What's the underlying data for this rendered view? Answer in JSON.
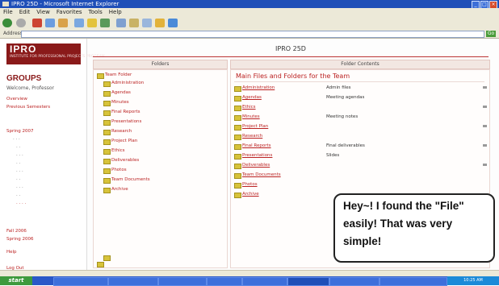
{
  "window": {
    "title": "IPRO 25D - Microsoft Internet Explorer"
  },
  "menu": [
    "File",
    "Edit",
    "View",
    "Favorites",
    "Tools",
    "Help"
  ],
  "address": {
    "label": "Address",
    "go_label": "Go"
  },
  "sidebar": {
    "logo_title": "IPRO",
    "logo_subtitle": "INSTITUTE FOR PROFESSIONAL PROJECTS PROGRAM",
    "groups_heading": "GROUPS",
    "welcome": "Welcome, Professor",
    "items": [
      "Overview",
      "Previous Semesters",
      "Spring 2007",
      "Fall 2006",
      "Spring 2006",
      "Help",
      "Log Out"
    ]
  },
  "main": {
    "title": "IPRO 25D",
    "left_header": "Folders",
    "right_header": "Folder Contents",
    "list_title": "Main Files and Folders for the Team"
  },
  "tree": [
    "Team Folder",
    "Administration",
    "Agendas",
    "Minutes",
    "Final Reports",
    "Presentations",
    "Research",
    "Project Plan",
    "Ethics",
    "Deliverables",
    "Photos",
    "Team Documents",
    "Archive"
  ],
  "rows": [
    {
      "link": "Administration",
      "desc": "Admin files"
    },
    {
      "link": "Agendas",
      "desc": "Meeting agendas"
    },
    {
      "link": "Ethics",
      "desc": ""
    },
    {
      "link": "Minutes",
      "desc": "Meeting notes"
    },
    {
      "link": "Project Plan",
      "desc": ""
    },
    {
      "link": "Research",
      "desc": ""
    },
    {
      "link": "Final Reports",
      "desc": "Final deliverables"
    },
    {
      "link": "Presentations",
      "desc": "Slides"
    },
    {
      "link": "Deliverables",
      "desc": ""
    },
    {
      "link": "Team Documents",
      "desc": ""
    },
    {
      "link": "Photos",
      "desc": ""
    },
    {
      "link": "Archive",
      "desc": ""
    }
  ],
  "callout": {
    "text": "Hey~! I found the \"File\" easily! That was very simple!"
  },
  "taskbar": {
    "start": "start",
    "tray_time": "10:25 AM"
  }
}
